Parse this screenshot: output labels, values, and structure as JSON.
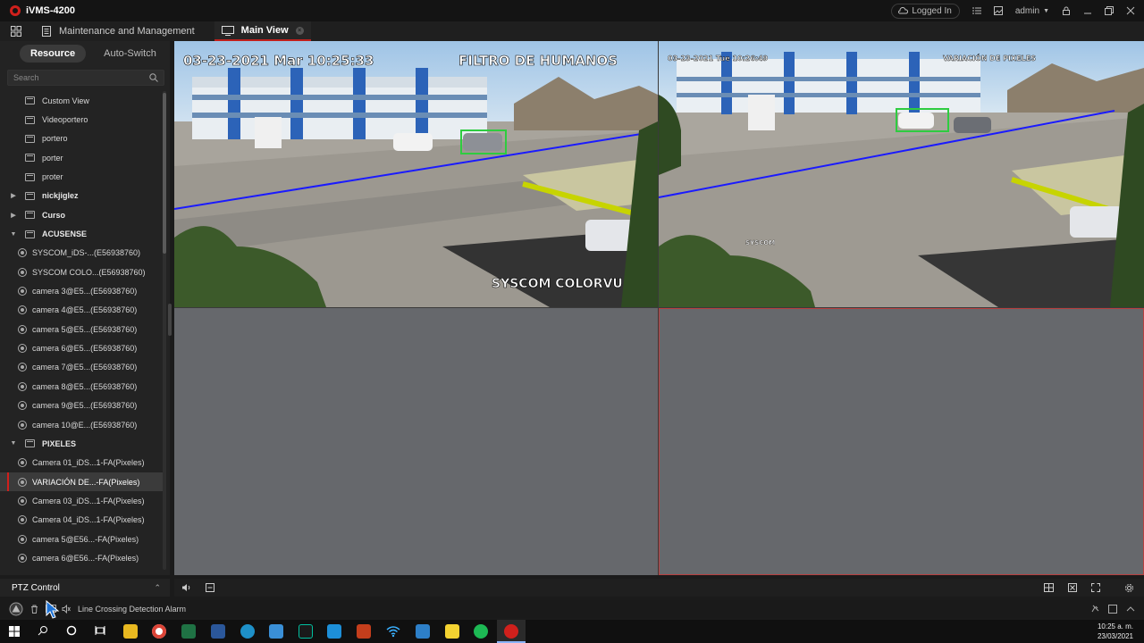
{
  "app": {
    "title": "iVMS-4200"
  },
  "titlebar": {
    "login_status": "Logged In",
    "user": "admin"
  },
  "tabs": [
    {
      "label": "Maintenance and Management"
    },
    {
      "label": "Main View"
    }
  ],
  "sidebar": {
    "tabs": [
      {
        "label": "Resource"
      },
      {
        "label": "Auto-Switch"
      }
    ],
    "search_placeholder": "Search",
    "tree": [
      {
        "label": "Custom View",
        "type": "view"
      },
      {
        "label": "Videoportero",
        "type": "folder"
      },
      {
        "label": "portero",
        "type": "folder"
      },
      {
        "label": "porter",
        "type": "folder"
      },
      {
        "label": "proter",
        "type": "folder"
      },
      {
        "label": "nickjiglez",
        "type": "group",
        "expanded": false
      },
      {
        "label": "Curso",
        "type": "group",
        "expanded": false
      },
      {
        "label": "ACUSENSE",
        "type": "group",
        "expanded": true
      },
      {
        "label": "SYSCOM_iDS-...(E56938760)",
        "type": "camera"
      },
      {
        "label": "SYSCOM COLO...(E56938760)",
        "type": "camera"
      },
      {
        "label": "camera 3@E5...(E56938760)",
        "type": "camera"
      },
      {
        "label": "camera 4@E5...(E56938760)",
        "type": "camera"
      },
      {
        "label": "camera 5@E5...(E56938760)",
        "type": "camera"
      },
      {
        "label": "camera 6@E5...(E56938760)",
        "type": "camera"
      },
      {
        "label": "camera 7@E5...(E56938760)",
        "type": "camera"
      },
      {
        "label": "camera 8@E5...(E56938760)",
        "type": "camera"
      },
      {
        "label": "camera 9@E5...(E56938760)",
        "type": "camera"
      },
      {
        "label": "camera 10@E...(E56938760)",
        "type": "camera"
      },
      {
        "label": "PIXELES",
        "type": "group",
        "expanded": true
      },
      {
        "label": "Camera 01_iDS...1-FA(Pixeles)",
        "type": "camera"
      },
      {
        "label": "VARIACIÓN DE...-FA(Pixeles)",
        "type": "camera",
        "selected": true
      },
      {
        "label": "Camera 03_iDS...1-FA(Pixeles)",
        "type": "camera"
      },
      {
        "label": "Camera 04_iDS...1-FA(Pixeles)",
        "type": "camera"
      },
      {
        "label": "camera 5@E56...-FA(Pixeles)",
        "type": "camera"
      },
      {
        "label": "camera 6@E56...-FA(Pixeles)",
        "type": "camera"
      }
    ],
    "ptz_label": "PTZ Control"
  },
  "views": {
    "cam1": {
      "timestamp": "03-23-2021 Mar 10:25:33",
      "overlay_title": "FILTRO DE HUMANOS",
      "channel_name": "SYSCOM COLORVU"
    },
    "cam2": {
      "timestamp": "03-23-2021 Tue 10:26:49",
      "overlay_title": "VARIACIÓN DE PIXELES",
      "channel_name": "SYSCOM"
    }
  },
  "statusbar": {
    "alarm_text": "Line Crossing Detection Alarm"
  },
  "taskbar": {
    "time": "10:25 a. m.",
    "date": "23/03/2021"
  },
  "colors": {
    "accent": "#d0201c",
    "line_crossing": "#1a1aff",
    "detection_box": "#2ecc40"
  }
}
